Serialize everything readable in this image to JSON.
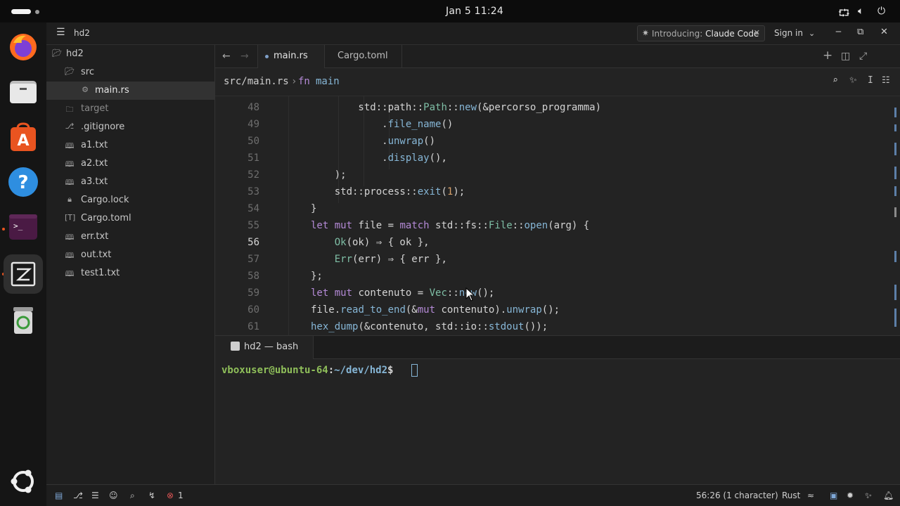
{
  "topbar": {
    "clock": "Jan 5  11:24"
  },
  "dock": {
    "apps": [
      "Firefox",
      "Files",
      "App Center",
      "Help",
      "Terminal",
      "Zed",
      "Trash",
      "Show Apps"
    ]
  },
  "window": {
    "project_name": "hd2",
    "announcement_prefix": "Introducing: ",
    "announcement_highlight": "Claude Code",
    "sign_in": "Sign in"
  },
  "sidebar": {
    "root": "hd2",
    "items": [
      {
        "label": "src"
      },
      {
        "label": "main.rs"
      },
      {
        "label": "target"
      },
      {
        "label": ".gitignore"
      },
      {
        "label": "a1.txt"
      },
      {
        "label": "a2.txt"
      },
      {
        "label": "a3.txt"
      },
      {
        "label": "Cargo.lock"
      },
      {
        "label": "Cargo.toml"
      },
      {
        "label": "err.txt"
      },
      {
        "label": "out.txt"
      },
      {
        "label": "test1.txt"
      }
    ]
  },
  "tabs": [
    {
      "label": "main.rs"
    },
    {
      "label": "Cargo.toml"
    }
  ],
  "breadcrumb": {
    "path": "src/main.rs",
    "separator": "›",
    "keyword": "fn",
    "symbol": "main"
  },
  "editor": {
    "current_line": 56,
    "lines": [
      {
        "n": "48",
        "t": "        std::path::Path::new(&percorso_programma)"
      },
      {
        "n": "49",
        "t": "            .file_name()"
      },
      {
        "n": "50",
        "t": "            .unwrap()"
      },
      {
        "n": "51",
        "t": "            .display(),"
      },
      {
        "n": "52",
        "t": "    );"
      },
      {
        "n": "53",
        "t": "    std::process::exit(1);"
      },
      {
        "n": "54",
        "t": "}"
      },
      {
        "n": "55",
        "t": "let mut file = match std::fs::File::open(arg) {"
      },
      {
        "n": "56",
        "t": "    Ok(ok) ⇒ { ok },"
      },
      {
        "n": "57",
        "t": "    Err(err) ⇒ { err },"
      },
      {
        "n": "58",
        "t": "};"
      },
      {
        "n": "59",
        "t": "let mut contenuto = Vec::new();"
      },
      {
        "n": "60",
        "t": "file.read_to_end(&mut contenuto).unwrap();"
      },
      {
        "n": "61",
        "t": "hex_dump(&contenuto, std::io::stdout());"
      }
    ]
  },
  "terminal": {
    "tab_label": "hd2 — bash",
    "prompt_user": "vboxuser@ubuntu-64",
    "prompt_sep": ":",
    "prompt_path": "~/dev/hd2",
    "prompt_symbol": "$"
  },
  "status": {
    "errors": "1",
    "cursor": "56:26 (1 character)",
    "language": "Rust"
  },
  "colors": {
    "accent": "#5c7fa8",
    "keyword": "#b48ad6",
    "type": "#7fbfa6",
    "function": "#86b6d6",
    "number": "#d6a06a",
    "prompt_user": "#8fbf5a",
    "prompt_path": "#86b6d6",
    "error": "#e05555"
  }
}
